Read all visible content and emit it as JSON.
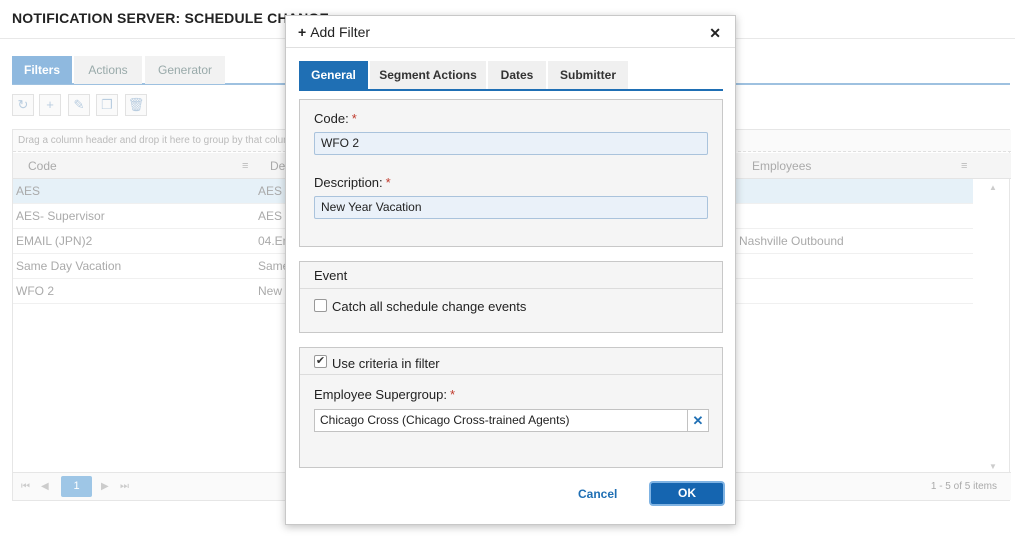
{
  "page": {
    "title": "NOTIFICATION SERVER: SCHEDULE CHANGE"
  },
  "tabs": [
    {
      "label": "Filters"
    },
    {
      "label": "Actions"
    },
    {
      "label": "Generator"
    }
  ],
  "toolbar": {
    "icons": [
      "refresh-icon",
      "plus-icon",
      "pencil-icon",
      "copy-icon",
      "trash-icon"
    ]
  },
  "grid": {
    "group_hint": "Drag a column header and drop it here to group by that colum",
    "columns": [
      {
        "label": "Code"
      },
      {
        "label": "Des"
      },
      {
        "label": "Employees"
      }
    ],
    "rows": [
      {
        "code": "AES",
        "desc": "AES",
        "employees": ""
      },
      {
        "code": "AES- Supervisor",
        "desc": "AES",
        "employees": ""
      },
      {
        "code": "EMAIL (JPN)2",
        "desc": "04.Em",
        "employees": "Nashville Outbound"
      },
      {
        "code": "Same Day Vacation",
        "desc": "Same",
        "employees": ""
      },
      {
        "code": "WFO 2",
        "desc": "New Y",
        "employees": ""
      }
    ],
    "pager": {
      "page": "1",
      "info": "1 - 5 of 5 items"
    }
  },
  "modal": {
    "title": "Add Filter",
    "tabs": [
      {
        "label": "General"
      },
      {
        "label": "Segment Actions"
      },
      {
        "label": "Dates"
      },
      {
        "label": "Submitter"
      }
    ],
    "code_label": "Code:",
    "code_value": "WFO 2",
    "description_label": "Description:",
    "description_value": "New Year Vacation",
    "event_title": "Event",
    "catch_all_label": "Catch all schedule change events",
    "catch_all_checked": false,
    "use_criteria_label": "Use criteria in filter",
    "use_criteria_checked": true,
    "supergroup_label": "Employee Supergroup:",
    "supergroup_value": "Chicago Cross (Chicago Cross-trained Agents)",
    "required_mark": "*",
    "cancel_label": "Cancel",
    "ok_label": "OK"
  },
  "colors": {
    "accent": "#1f6fb4",
    "tab_active": "#8fb9df",
    "required": "#c0392b"
  }
}
